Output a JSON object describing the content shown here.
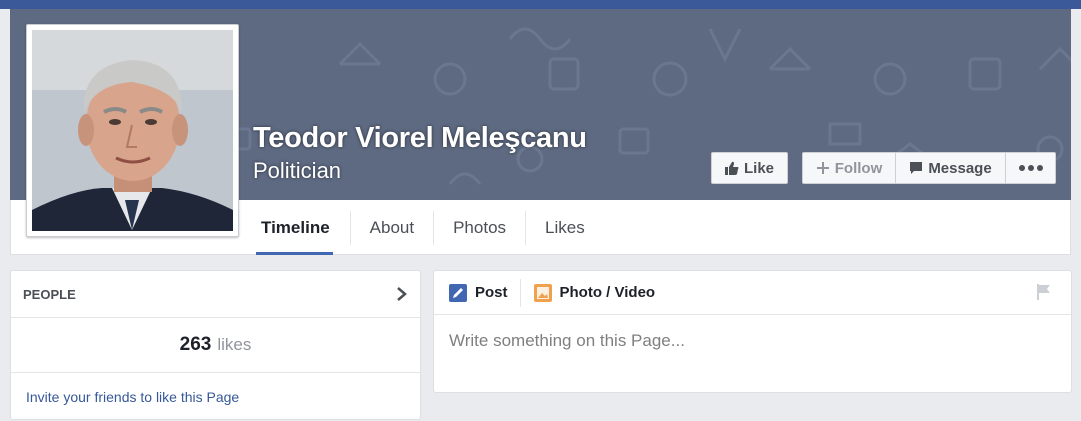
{
  "page": {
    "name": "Teodor Viorel Meleşcanu",
    "category": "Politician"
  },
  "actions": {
    "like": "Like",
    "follow": "Follow",
    "message": "Message"
  },
  "tabs": [
    "Timeline",
    "About",
    "Photos",
    "Likes"
  ],
  "people": {
    "header": "PEOPLE",
    "count": "263",
    "count_label": "likes",
    "invite": "Invite your friends to like this Page"
  },
  "composer": {
    "post_tab": "Post",
    "photo_tab": "Photo / Video",
    "placeholder": "Write something on this Page..."
  },
  "colors": {
    "brand": "#3b5998",
    "cover": "#5e6a82",
    "link": "#365899",
    "active_tab": "#4267b2"
  }
}
